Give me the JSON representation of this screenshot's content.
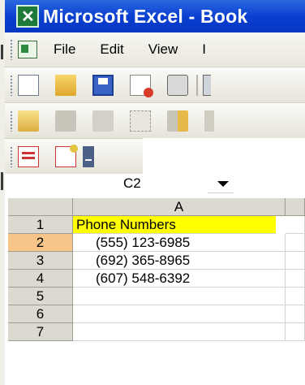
{
  "window": {
    "title": "Microsoft Excel - Book"
  },
  "menubar": {
    "items": [
      "File",
      "Edit",
      "View",
      "I"
    ]
  },
  "toolbar": {
    "row1_icons": [
      "new-document-icon",
      "open-folder-icon",
      "save-icon",
      "permission-icon",
      "print-icon"
    ],
    "row2_icons": [
      "folder-icon",
      "back-icon",
      "forward-icon",
      "box-icon",
      "mixed-icon",
      "x-icon"
    ],
    "row3_icons": [
      "pdf-icon",
      "pdf-settings-icon",
      "toolbar-options-icon"
    ]
  },
  "name_box": {
    "value": "C2"
  },
  "grid": {
    "columns": [
      "A"
    ],
    "rows": [
      {
        "num": "1",
        "a": "Phone Numbers"
      },
      {
        "num": "2",
        "a": "(555) 123-6985"
      },
      {
        "num": "3",
        "a": "(692) 365-8965"
      },
      {
        "num": "4",
        "a": "(607) 548-6392"
      },
      {
        "num": "5",
        "a": ""
      },
      {
        "num": "6",
        "a": ""
      },
      {
        "num": "7",
        "a": ""
      }
    ],
    "highlight_color": "#ffff00",
    "active_row_header_color": "#f7c58a"
  }
}
